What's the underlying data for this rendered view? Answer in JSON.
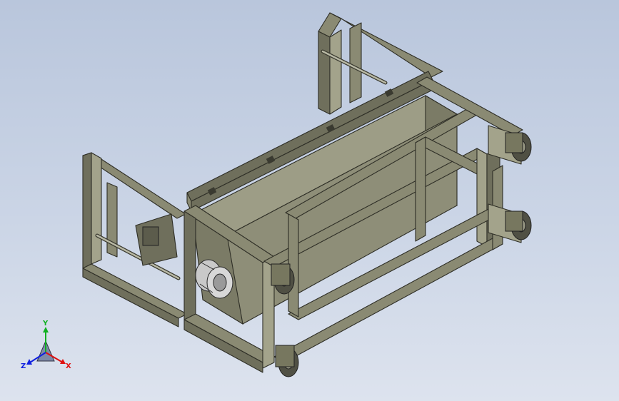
{
  "viewport": {
    "background_top": "#b9c6dc",
    "background_bottom": "#dde3ee",
    "model_color": "#8a8a73"
  },
  "triad": {
    "x_label": "X",
    "y_label": "Y",
    "z_label": "Z",
    "x_color": "#e01010",
    "y_color": "#10b020",
    "z_color": "#1020e0"
  }
}
